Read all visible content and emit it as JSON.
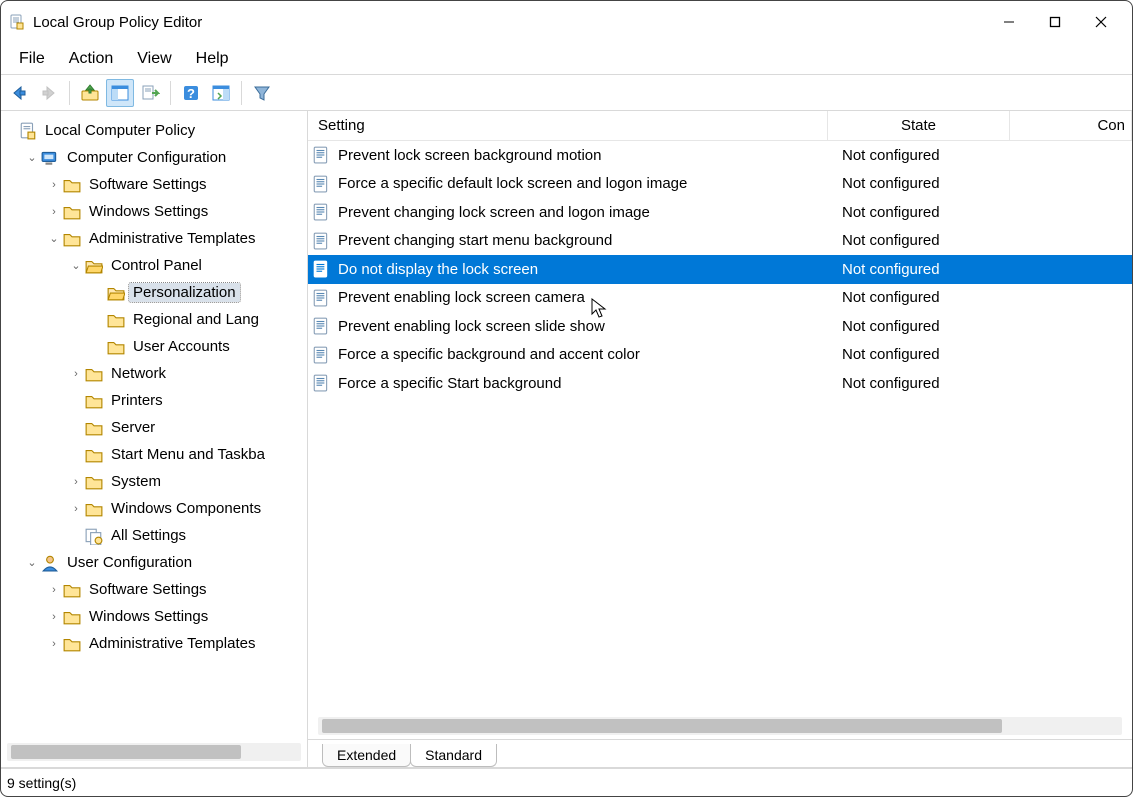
{
  "window": {
    "title": "Local Group Policy Editor"
  },
  "menu": [
    "File",
    "Action",
    "View",
    "Help"
  ],
  "toolbar_buttons": [
    {
      "name": "back-button",
      "label": "Back"
    },
    {
      "name": "forward-button",
      "label": "Forward"
    },
    {
      "name": "up-button",
      "label": "Up One Level"
    },
    {
      "name": "show-hide-tree-button",
      "label": "Show/Hide Console Tree",
      "toggled": true
    },
    {
      "name": "export-list-button",
      "label": "Export List"
    },
    {
      "name": "help-button",
      "label": "Help"
    },
    {
      "name": "show-hide-actions-button",
      "label": "Show/Hide Action Pane"
    },
    {
      "name": "filter-button",
      "label": "Filter"
    }
  ],
  "tree_root": "Local Computer Policy",
  "computer_config": {
    "label": "Computer Configuration",
    "children": {
      "software": "Software Settings",
      "windows": "Windows Settings",
      "admin_templates": {
        "label": "Administrative Templates",
        "children": {
          "control_panel": {
            "label": "Control Panel",
            "children": {
              "personalization": "Personalization",
              "regional": "Regional and Lang",
              "user_accounts": "User Accounts"
            }
          },
          "network": "Network",
          "printers": "Printers",
          "server": "Server",
          "start_menu": "Start Menu and Taskba",
          "system": "System",
          "windows_components": "Windows Components",
          "all_settings": "All Settings"
        }
      }
    }
  },
  "user_config": {
    "label": "User Configuration",
    "children": {
      "software": "Software Settings",
      "windows": "Windows Settings",
      "admin_templates": "Administrative Templates"
    }
  },
  "columns": {
    "setting": "Setting",
    "state": "State",
    "comment": "Con"
  },
  "settings": [
    {
      "name": "Prevent lock screen background motion",
      "state": "Not configured"
    },
    {
      "name": "Force a specific default lock screen and logon image",
      "state": "Not configured"
    },
    {
      "name": "Prevent changing lock screen and logon image",
      "state": "Not configured"
    },
    {
      "name": "Prevent changing start menu background",
      "state": "Not configured"
    },
    {
      "name": "Do not display the lock screen",
      "state": "Not configured",
      "selected": true
    },
    {
      "name": "Prevent enabling lock screen camera",
      "state": "Not configured"
    },
    {
      "name": "Prevent enabling lock screen slide show",
      "state": "Not configured"
    },
    {
      "name": "Force a specific background and accent color",
      "state": "Not configured"
    },
    {
      "name": "Force a specific Start background",
      "state": "Not configured"
    }
  ],
  "tabs": {
    "extended": "Extended",
    "standard": "Standard"
  },
  "statusbar": {
    "count": "9 setting(s)"
  }
}
